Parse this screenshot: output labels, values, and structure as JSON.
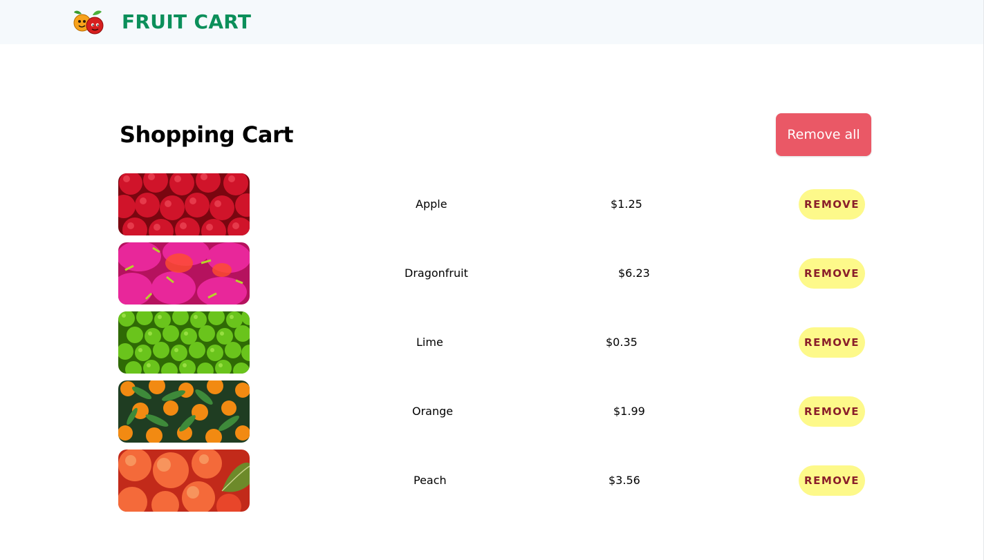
{
  "header": {
    "brand": "FRUIT CART",
    "logo_icon": "fruit-mascot-icon"
  },
  "cart": {
    "title": "Shopping Cart",
    "remove_all_label": "Remove all",
    "items": [
      {
        "name": "Apple",
        "price": "$1.25",
        "remove_label": "REMOVE",
        "image_icon": "apple-photo"
      },
      {
        "name": "Dragonfruit",
        "price": "$6.23",
        "remove_label": "REMOVE",
        "image_icon": "dragonfruit-photo"
      },
      {
        "name": "Lime",
        "price": "$0.35",
        "remove_label": "REMOVE",
        "image_icon": "lime-photo"
      },
      {
        "name": "Orange",
        "price": "$1.99",
        "remove_label": "REMOVE",
        "image_icon": "orange-photo"
      },
      {
        "name": "Peach",
        "price": "$3.56",
        "remove_label": "REMOVE",
        "image_icon": "peach-photo"
      }
    ]
  },
  "colors": {
    "brand": "#0b8f5a",
    "header_bg": "#f5f9fc",
    "remove_all_bg": "#ea5866",
    "remove_bg": "#fdf98a",
    "remove_text": "#8a1f2a"
  }
}
